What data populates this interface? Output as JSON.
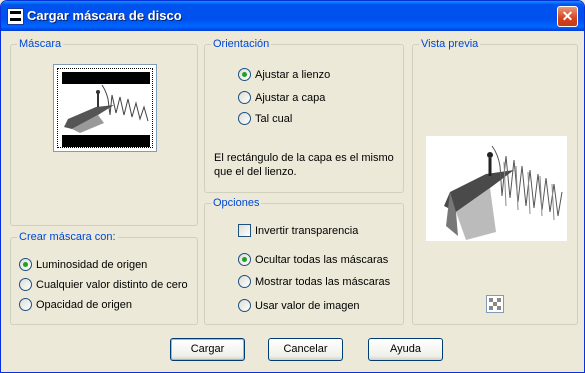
{
  "window": {
    "title": "Cargar máscara de disco",
    "close": "✕"
  },
  "mascara": {
    "legend": "Máscara"
  },
  "crear": {
    "legend": "Crear máscara con:",
    "options": [
      "Luminosidad de origen",
      "Cualquier valor distinto de cero",
      "Opacidad de origen"
    ],
    "selected": 0
  },
  "orientacion": {
    "legend": "Orientación",
    "options": [
      "Ajustar a lienzo",
      "Ajustar a capa",
      "Tal cual"
    ],
    "selected": 0,
    "info": "El rectángulo de la capa es el mismo que el del lienzo."
  },
  "opciones": {
    "legend": "Opciones",
    "invert": "Invertir transparencia",
    "invert_checked": false,
    "radios": [
      "Ocultar todas las máscaras",
      "Mostrar todas las máscaras",
      "Usar valor de imagen"
    ],
    "selected": 0
  },
  "preview": {
    "legend": "Vista previa"
  },
  "buttons": {
    "load": "Cargar",
    "cancel": "Cancelar",
    "help": "Ayuda"
  }
}
